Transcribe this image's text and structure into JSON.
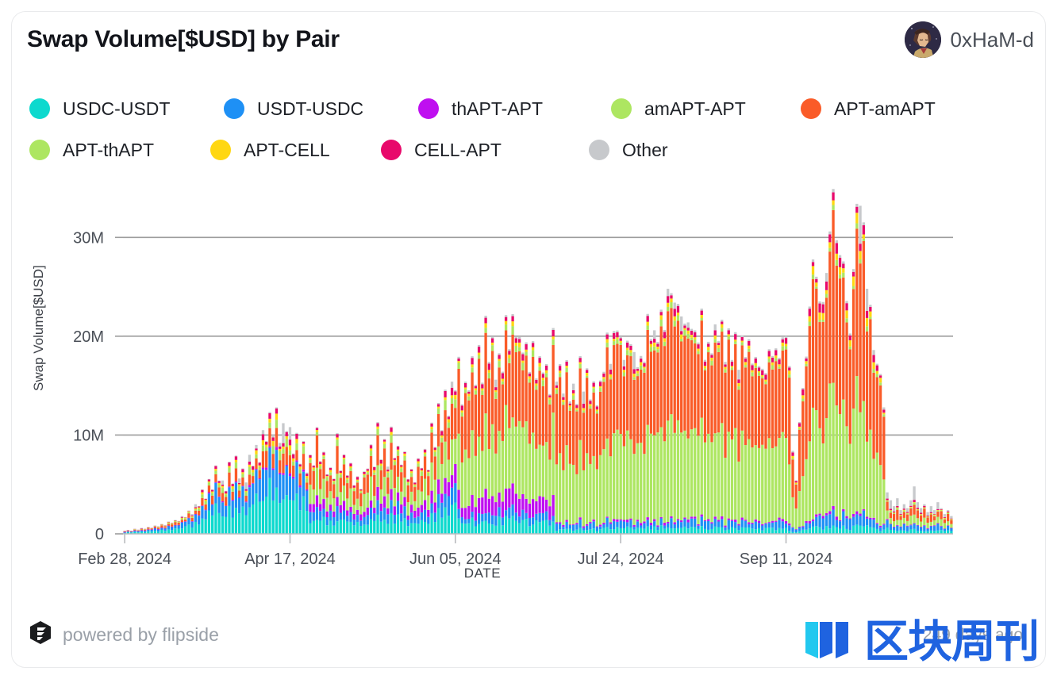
{
  "header": {
    "title": "Swap Volume[$USD] by Pair",
    "user": "0xHaM-d",
    "avatar_icon": "user-avatar-pixel-art"
  },
  "footer": {
    "powered_by": "powered by flipside",
    "logo_icon": "flipside-hexagon-logo",
    "timestamp": "249 days ago",
    "watermark_text": "区块周刊",
    "watermark_icon": "blue-bars-logo",
    "watermark_color": "#1f63e0"
  },
  "chart_data": {
    "type": "bar",
    "stacked": true,
    "title": "Swap Volume[$USD] by Pair",
    "xlabel": "DATE",
    "ylabel": "Swap Volume[$USD]",
    "ylim": [
      0,
      35000000
    ],
    "yticks": [
      0,
      10000000,
      20000000,
      30000000
    ],
    "ytick_labels": [
      "0",
      "10M",
      "20M",
      "30M"
    ],
    "grid": "horizontal",
    "legend_position": "top",
    "x_start": "Feb 28, 2024",
    "x_end": "Oct 30, 2024",
    "xtick_labels": [
      "Feb 28, 2024",
      "Apr 17, 2024",
      "Jun 05, 2024",
      "Jul 24, 2024",
      "Sep 11, 2024"
    ],
    "xtick_index": [
      0,
      49,
      98,
      147,
      196
    ],
    "n_points": 246,
    "series": [
      {
        "name": "USDC-USDT",
        "color": "#0DD9CE"
      },
      {
        "name": "USDT-USDC",
        "color": "#1E90F5"
      },
      {
        "name": "thAPT-APT",
        "color": "#BF0FF0"
      },
      {
        "name": "amAPT-APT",
        "color": "#ADE661"
      },
      {
        "name": "APT-amAPT",
        "color": "#FA5B28"
      },
      {
        "name": "APT-thAPT",
        "color": "#ADE661"
      },
      {
        "name": "APT-CELL",
        "color": "#FFD712"
      },
      {
        "name": "CELL-APT",
        "color": "#E8096B"
      },
      {
        "name": "Other",
        "color": "#C7C9CC"
      }
    ],
    "stack_order": [
      "USDC-USDT",
      "USDT-USDC",
      "thAPT-APT",
      "amAPT-APT",
      "APT-amAPT",
      "APT-thAPT",
      "APT-CELL",
      "CELL-APT",
      "Other"
    ],
    "totals_millions": [
      0.3,
      0.4,
      0.3,
      0.5,
      0.4,
      0.6,
      0.5,
      0.7,
      0.6,
      0.8,
      0.7,
      1.0,
      0.9,
      1.2,
      1.1,
      1.4,
      1.3,
      1.8,
      1.6,
      2.2,
      2.0,
      3.0,
      2.6,
      4.4,
      3.2,
      5.0,
      4.0,
      6.5,
      4.6,
      5.4,
      4.2,
      6.8,
      5.0,
      7.2,
      5.6,
      6.0,
      5.2,
      8.0,
      6.2,
      9.0,
      7.0,
      10.5,
      8.2,
      11.8,
      10.0,
      12.4,
      9.2,
      11.2,
      8.4,
      10.8,
      7.6,
      9.4,
      6.8,
      8.2,
      6.2,
      7.4,
      5.8,
      9.2,
      6.6,
      7.8,
      5.4,
      6.6,
      5.0,
      8.8,
      6.0,
      7.0,
      5.2,
      6.4,
      4.8,
      5.8,
      4.4,
      6.0,
      5.6,
      7.6,
      6.4,
      9.8,
      7.4,
      8.6,
      6.8,
      10.2,
      7.2,
      8.4,
      6.0,
      7.2,
      5.4,
      6.4,
      5.0,
      6.8,
      5.8,
      7.4,
      6.2,
      9.0,
      7.6,
      11.4,
      9.8,
      13.6,
      11.6,
      15.4,
      13.2,
      16.2,
      12.8,
      14.6,
      13.4,
      16.8,
      14.2,
      17.6,
      15.2,
      20.8,
      16.4,
      18.2,
      15.6,
      17.4,
      14.8,
      19.6,
      16.2,
      20.4,
      17.2,
      19.2,
      16.6,
      18.4,
      15.4,
      17.2,
      14.6,
      16.4,
      13.8,
      15.6,
      13.2,
      19.2,
      15.4,
      17.0,
      14.2,
      16.0,
      13.4,
      15.2,
      12.8,
      17.2,
      14.4,
      16.2,
      13.6,
      15.0,
      12.4,
      14.2,
      16.4,
      18.6,
      17.2,
      20.2,
      18.4,
      19.4,
      17.6,
      19.0,
      17.0,
      18.4,
      16.4,
      18.0,
      16.8,
      19.8,
      18.2,
      20.6,
      19.0,
      22.4,
      20.2,
      24.8,
      21.6,
      23.4,
      20.4,
      22.0,
      19.6,
      21.4,
      18.8,
      20.4,
      18.2,
      19.8,
      17.6,
      19.2,
      17.0,
      21.2,
      18.6,
      20.0,
      17.4,
      19.4,
      17.2,
      18.8,
      16.6,
      18.2,
      16.0,
      17.8,
      15.4,
      17.0,
      14.8,
      16.4,
      15.8,
      17.4,
      16.2,
      18.0,
      17.0,
      19.4,
      18.6,
      15.8,
      8.4,
      5.2,
      11.2,
      13.6,
      17.8,
      21.6,
      25.8,
      23.2,
      20.4,
      22.8,
      26.4,
      29.8,
      34.0,
      28.6,
      26.2,
      24.4,
      22.0,
      19.6,
      26.8,
      30.2,
      33.2,
      29.4,
      24.8,
      21.2,
      18.6,
      16.2,
      14.4,
      12.8,
      4.2,
      3.4,
      2.8,
      3.6,
      2.4,
      3.0,
      2.6,
      3.4,
      4.8,
      3.2,
      2.6,
      3.0,
      2.2,
      2.8,
      2.4,
      3.2,
      2.6,
      2.0,
      2.4,
      1.8
    ]
  }
}
